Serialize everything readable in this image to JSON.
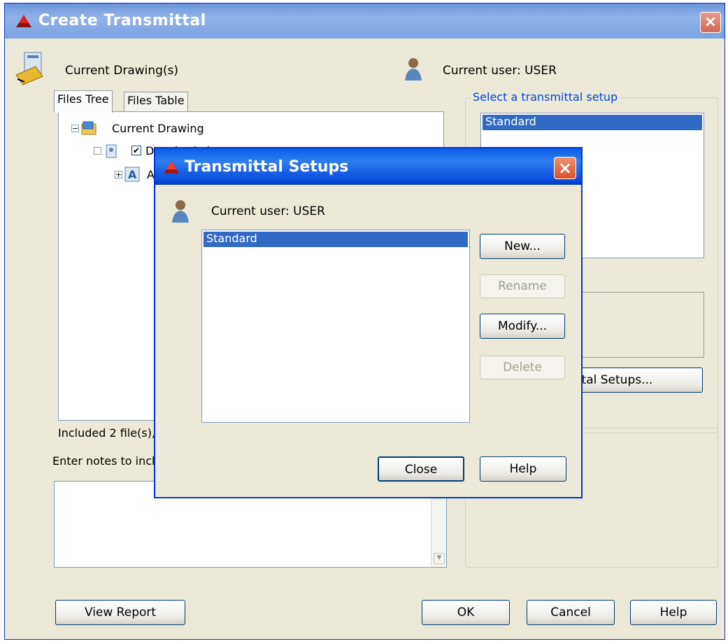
{
  "main_window": {
    "title": "Create Transmittal",
    "current_drawings_label": "Current Drawing(s)",
    "current_user_label": "Current user: USER",
    "tabs": [
      "Files Tree",
      "Files Table"
    ],
    "tree": {
      "root": "Current Drawing",
      "child1": "Drawing1.dwg",
      "child2": "A"
    },
    "included_text": "Included 2 file(s),",
    "notes_label": "Enter notes to incl",
    "setup_group_title": "Select a transmittal setup",
    "setups": [
      "Standard"
    ],
    "transmittal_setups_button": "Transmittal Setups...",
    "view_report_button": "View Report",
    "ok_button": "OK",
    "cancel_button": "Cancel",
    "help_button": "Help"
  },
  "dialog": {
    "title": "Transmittal Setups",
    "current_user_label": "Current user: USER",
    "setups": [
      "Standard"
    ],
    "new_button": "New...",
    "rename_button": "Rename",
    "modify_button": "Modify...",
    "delete_button": "Delete",
    "close_button": "Close",
    "help_button": "Help"
  },
  "colors": {
    "selection": "#316ac5",
    "dialog_titlebar": "#0b4fdc",
    "main_titlebar_inactive": "#7aa3e2",
    "group_title": "#0046d5"
  }
}
